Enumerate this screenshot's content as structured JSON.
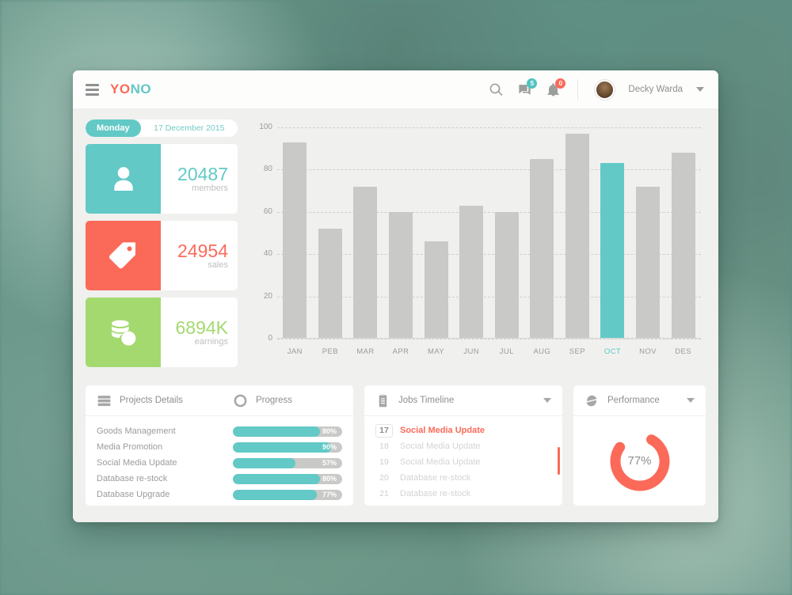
{
  "header": {
    "menu_icon": "hamburger-icon",
    "logo_part1": "YO",
    "logo_part2": "NO",
    "search_icon": "search-icon",
    "messages_icon": "message-icon",
    "messages_badge": "5",
    "notifications_icon": "bell-icon",
    "notifications_badge": "0",
    "username": "Decky Warda",
    "caret_icon": "chevron-down-icon",
    "colors": {
      "teal": "#62c9c6",
      "red": "#fb6a59",
      "green": "#a4d970"
    }
  },
  "date": {
    "day": "Monday",
    "full": "17 December 2015"
  },
  "stats": [
    {
      "icon": "user-icon",
      "value": "20487",
      "label": "members",
      "color": "teal"
    },
    {
      "icon": "tag-icon",
      "value": "24954",
      "label": "sales",
      "color": "red"
    },
    {
      "icon": "coins-icon",
      "value": "6894K",
      "label": "earnings",
      "color": "green"
    }
  ],
  "chart_data": {
    "type": "bar",
    "title": "",
    "xlabel": "",
    "ylabel": "",
    "ylim": [
      0,
      100
    ],
    "yticks": [
      0,
      20,
      40,
      60,
      80,
      100
    ],
    "grid": true,
    "legend": "none",
    "highlight_index": 9,
    "highlight_color": "#62c9c6",
    "bar_color": "#c9c9c7",
    "categories": [
      "JAN",
      "PEB",
      "MAR",
      "APR",
      "MAY",
      "JUN",
      "JUL",
      "AUG",
      "SEP",
      "OCT",
      "NOV",
      "DES"
    ],
    "values": [
      93,
      52,
      72,
      60,
      46,
      63,
      60,
      85,
      97,
      83,
      72,
      88
    ]
  },
  "projects": {
    "icon": "list-icon",
    "title": "Projects Details",
    "progress_icon": "circle-icon",
    "progress_title": "Progress",
    "rows": [
      {
        "name": "Goods Management",
        "percent": 80,
        "label": "80%"
      },
      {
        "name": "Media Promotion",
        "percent": 90,
        "label": "90%"
      },
      {
        "name": "Social Media Update",
        "percent": 57,
        "label": "57%"
      },
      {
        "name": "Database re-stock",
        "percent": 80,
        "label": "80%"
      },
      {
        "name": "Database Upgrade",
        "percent": 77,
        "label": "77%"
      }
    ]
  },
  "jobs": {
    "icon": "clipboard-icon",
    "title": "Jobs Timeline",
    "caret_icon": "chevron-down-icon",
    "items": [
      {
        "num": "17",
        "name": "Social Media Update",
        "active": true
      },
      {
        "num": "18",
        "name": "Social Media Update",
        "active": false
      },
      {
        "num": "19",
        "name": "Social Media Update",
        "active": false
      },
      {
        "num": "20",
        "name": "Database re-stock",
        "active": false
      },
      {
        "num": "21",
        "name": "Database re-stock",
        "active": false
      }
    ]
  },
  "performance": {
    "icon": "chart-pie-icon",
    "title": "Performance",
    "caret_icon": "chevron-down-icon",
    "percent": 77,
    "percent_label": "77%",
    "color": "#fb6a59"
  }
}
